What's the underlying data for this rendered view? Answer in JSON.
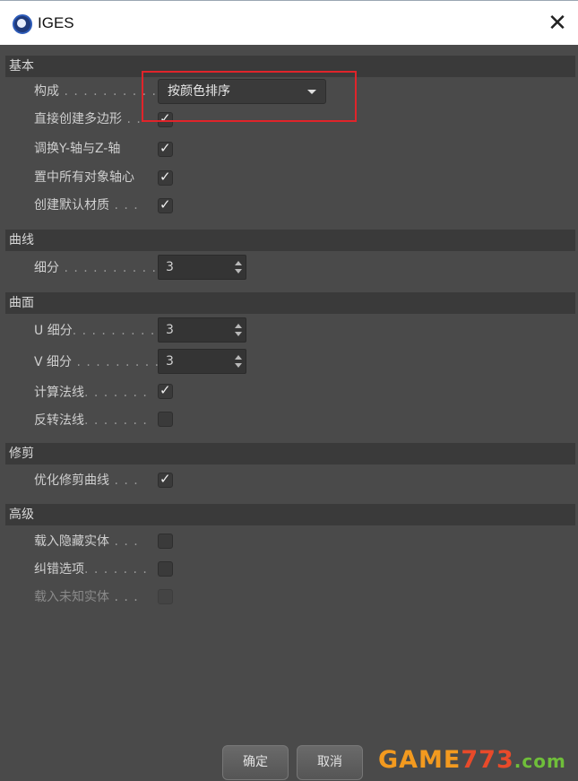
{
  "window": {
    "title": "IGES",
    "close_glyph": "✕"
  },
  "sections": {
    "basic": {
      "header": "基本",
      "composition": {
        "label": "构成",
        "dots": " . . . . . . . . . .",
        "value": "按颜色排序"
      },
      "create_polygons": {
        "label": "直接创建多边形",
        "dots": " . .",
        "checked": true
      },
      "swap_yz": {
        "label": "调换Y-轴与Z-轴",
        "dots": "",
        "checked": true
      },
      "center_axes": {
        "label": "置中所有对象轴心",
        "dots": "",
        "checked": true
      },
      "default_material": {
        "label": "创建默认材质",
        "dots": " . . .",
        "checked": true
      }
    },
    "curves": {
      "header": "曲线",
      "subdivision": {
        "label": "细分",
        "dots": " . . . . . . . . . . .",
        "value": "3"
      }
    },
    "surfaces": {
      "header": "曲面",
      "u_subdivision": {
        "label": "U 细分",
        "dots": ". . . . . . . . .",
        "value": "3"
      },
      "v_subdivision": {
        "label": "V 细分",
        "dots": " . . . . . . . . .",
        "value": "3"
      },
      "compute_normals": {
        "label": "计算法线",
        "dots": ". . . . . . .",
        "checked": true
      },
      "reverse_normals": {
        "label": "反转法线",
        "dots": ". . . . . . .",
        "checked": false
      }
    },
    "trim": {
      "header": "修剪",
      "optimize_trim": {
        "label": "优化修剪曲线",
        "dots": " . . .",
        "checked": true
      }
    },
    "advanced": {
      "header": "高级",
      "load_hidden": {
        "label": "载入隐藏实体",
        "dots": " . . .",
        "checked": false
      },
      "error_options": {
        "label": "纠错选项",
        "dots": ". . . . . . .",
        "checked": false
      },
      "load_unknown": {
        "label": "载入未知实体",
        "dots": " . . .",
        "checked": false,
        "disabled": true
      }
    }
  },
  "buttons": {
    "ok": "确定",
    "cancel": "取消"
  },
  "watermark": {
    "part1": "GAME",
    "part2": "773",
    "part3": ".com"
  },
  "colors": {
    "background": "#4a4a4a",
    "section_header": "#3a3a3a",
    "highlight": "#e0242a"
  }
}
